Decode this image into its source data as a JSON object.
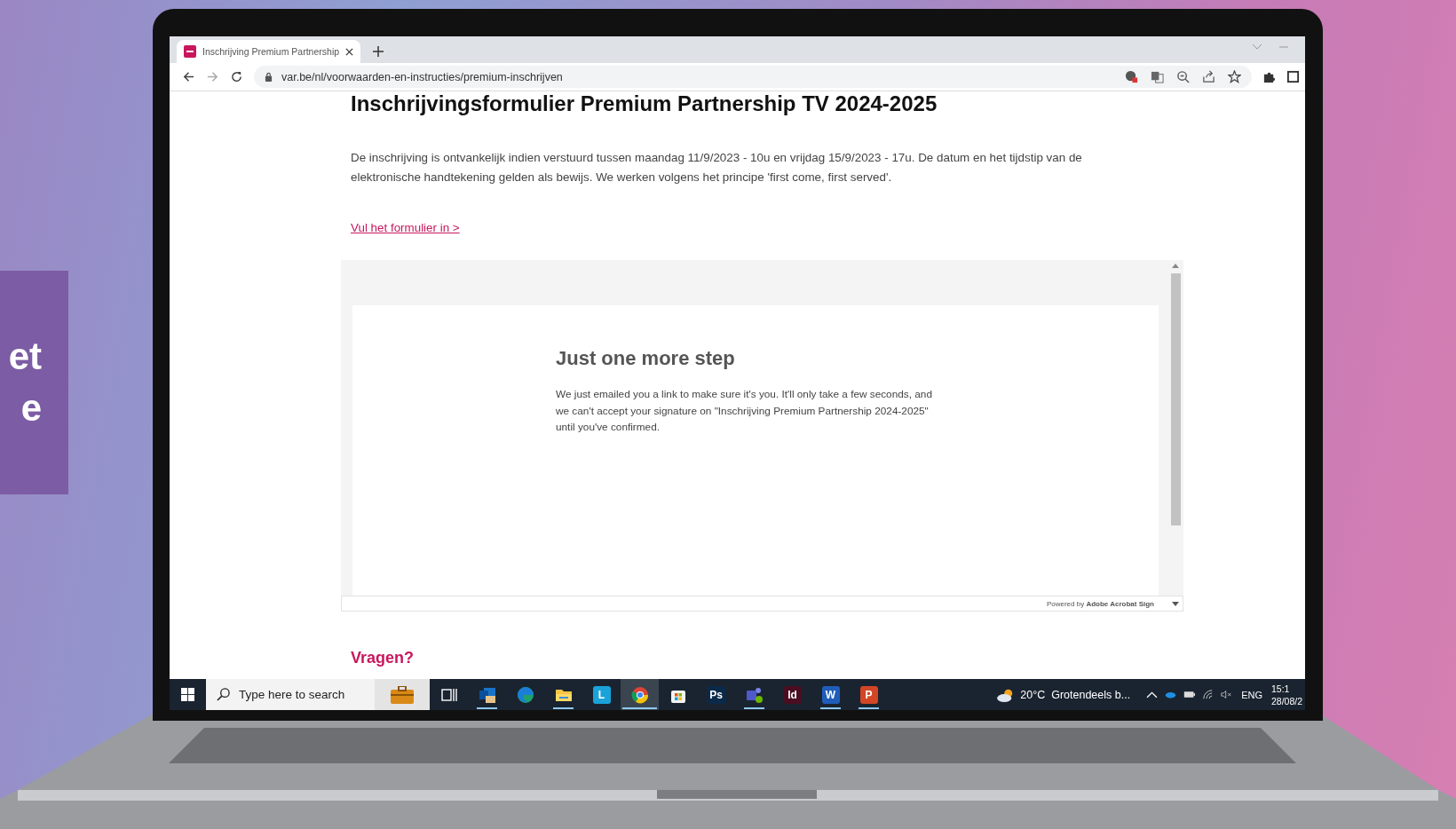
{
  "slide": {
    "side_text": [
      "et",
      "e"
    ]
  },
  "browser": {
    "tab": {
      "title": "Inschrijving Premium Partnership",
      "selected": true
    },
    "url": "var.be/nl/voorwaarden-en-instructies/premium-inschrijven"
  },
  "page": {
    "title": "Inschrijvingsformulier Premium Partnership TV 2024-2025",
    "intro": "De inschrijving is ontvankelijk indien verstuurd tussen maandag 11/9/2023 - 10u en vrijdag 15/9/2023 - 17u. De datum en het tijdstip van de elektronische handtekening gelden als bewijs. We werken volgens het principe 'first come, first served'.",
    "form_link": "Vul het formulier in >",
    "embed": {
      "heading": "Just one more step",
      "body": "We just emailed you a link to make sure it's you. It'll only take a few seconds, and we can't accept your signature on \"Inschrijving Premium Partnership 2024-2025\" until you've confirmed.",
      "powered_by": "Powered by **Adobe Acrobat Sign**"
    },
    "questions_heading": "Vragen?"
  },
  "taskbar": {
    "search_placeholder": "Type here to search",
    "apps": [
      {
        "kind": "taskview",
        "running": false,
        "selected": false
      },
      {
        "kind": "mail",
        "running": true,
        "selected": false
      },
      {
        "kind": "edge",
        "running": false,
        "selected": false
      },
      {
        "kind": "folder",
        "running": true,
        "selected": false
      },
      {
        "kind": "letter",
        "glyph": "L",
        "color": "#1aa3d9",
        "running": false,
        "selected": false
      },
      {
        "kind": "chrome",
        "running": true,
        "selected": true
      },
      {
        "kind": "store",
        "running": false,
        "selected": false
      },
      {
        "kind": "letter",
        "glyph": "Ps",
        "color": "#0b2a4a",
        "running": false,
        "selected": false
      },
      {
        "kind": "teams",
        "running": true,
        "selected": false
      },
      {
        "kind": "letter",
        "glyph": "Id",
        "color": "#4a0d22",
        "running": false,
        "selected": false
      },
      {
        "kind": "letter",
        "glyph": "W",
        "color": "#1f5db8",
        "running": true,
        "selected": false
      },
      {
        "kind": "letter",
        "glyph": "P",
        "color": "#d24625",
        "running": true,
        "selected": false
      }
    ],
    "weather": {
      "temperature": "20°C",
      "condition": "Grotendeels b..."
    },
    "language": "ENG",
    "time": "15:1",
    "date": "28/08/2"
  }
}
